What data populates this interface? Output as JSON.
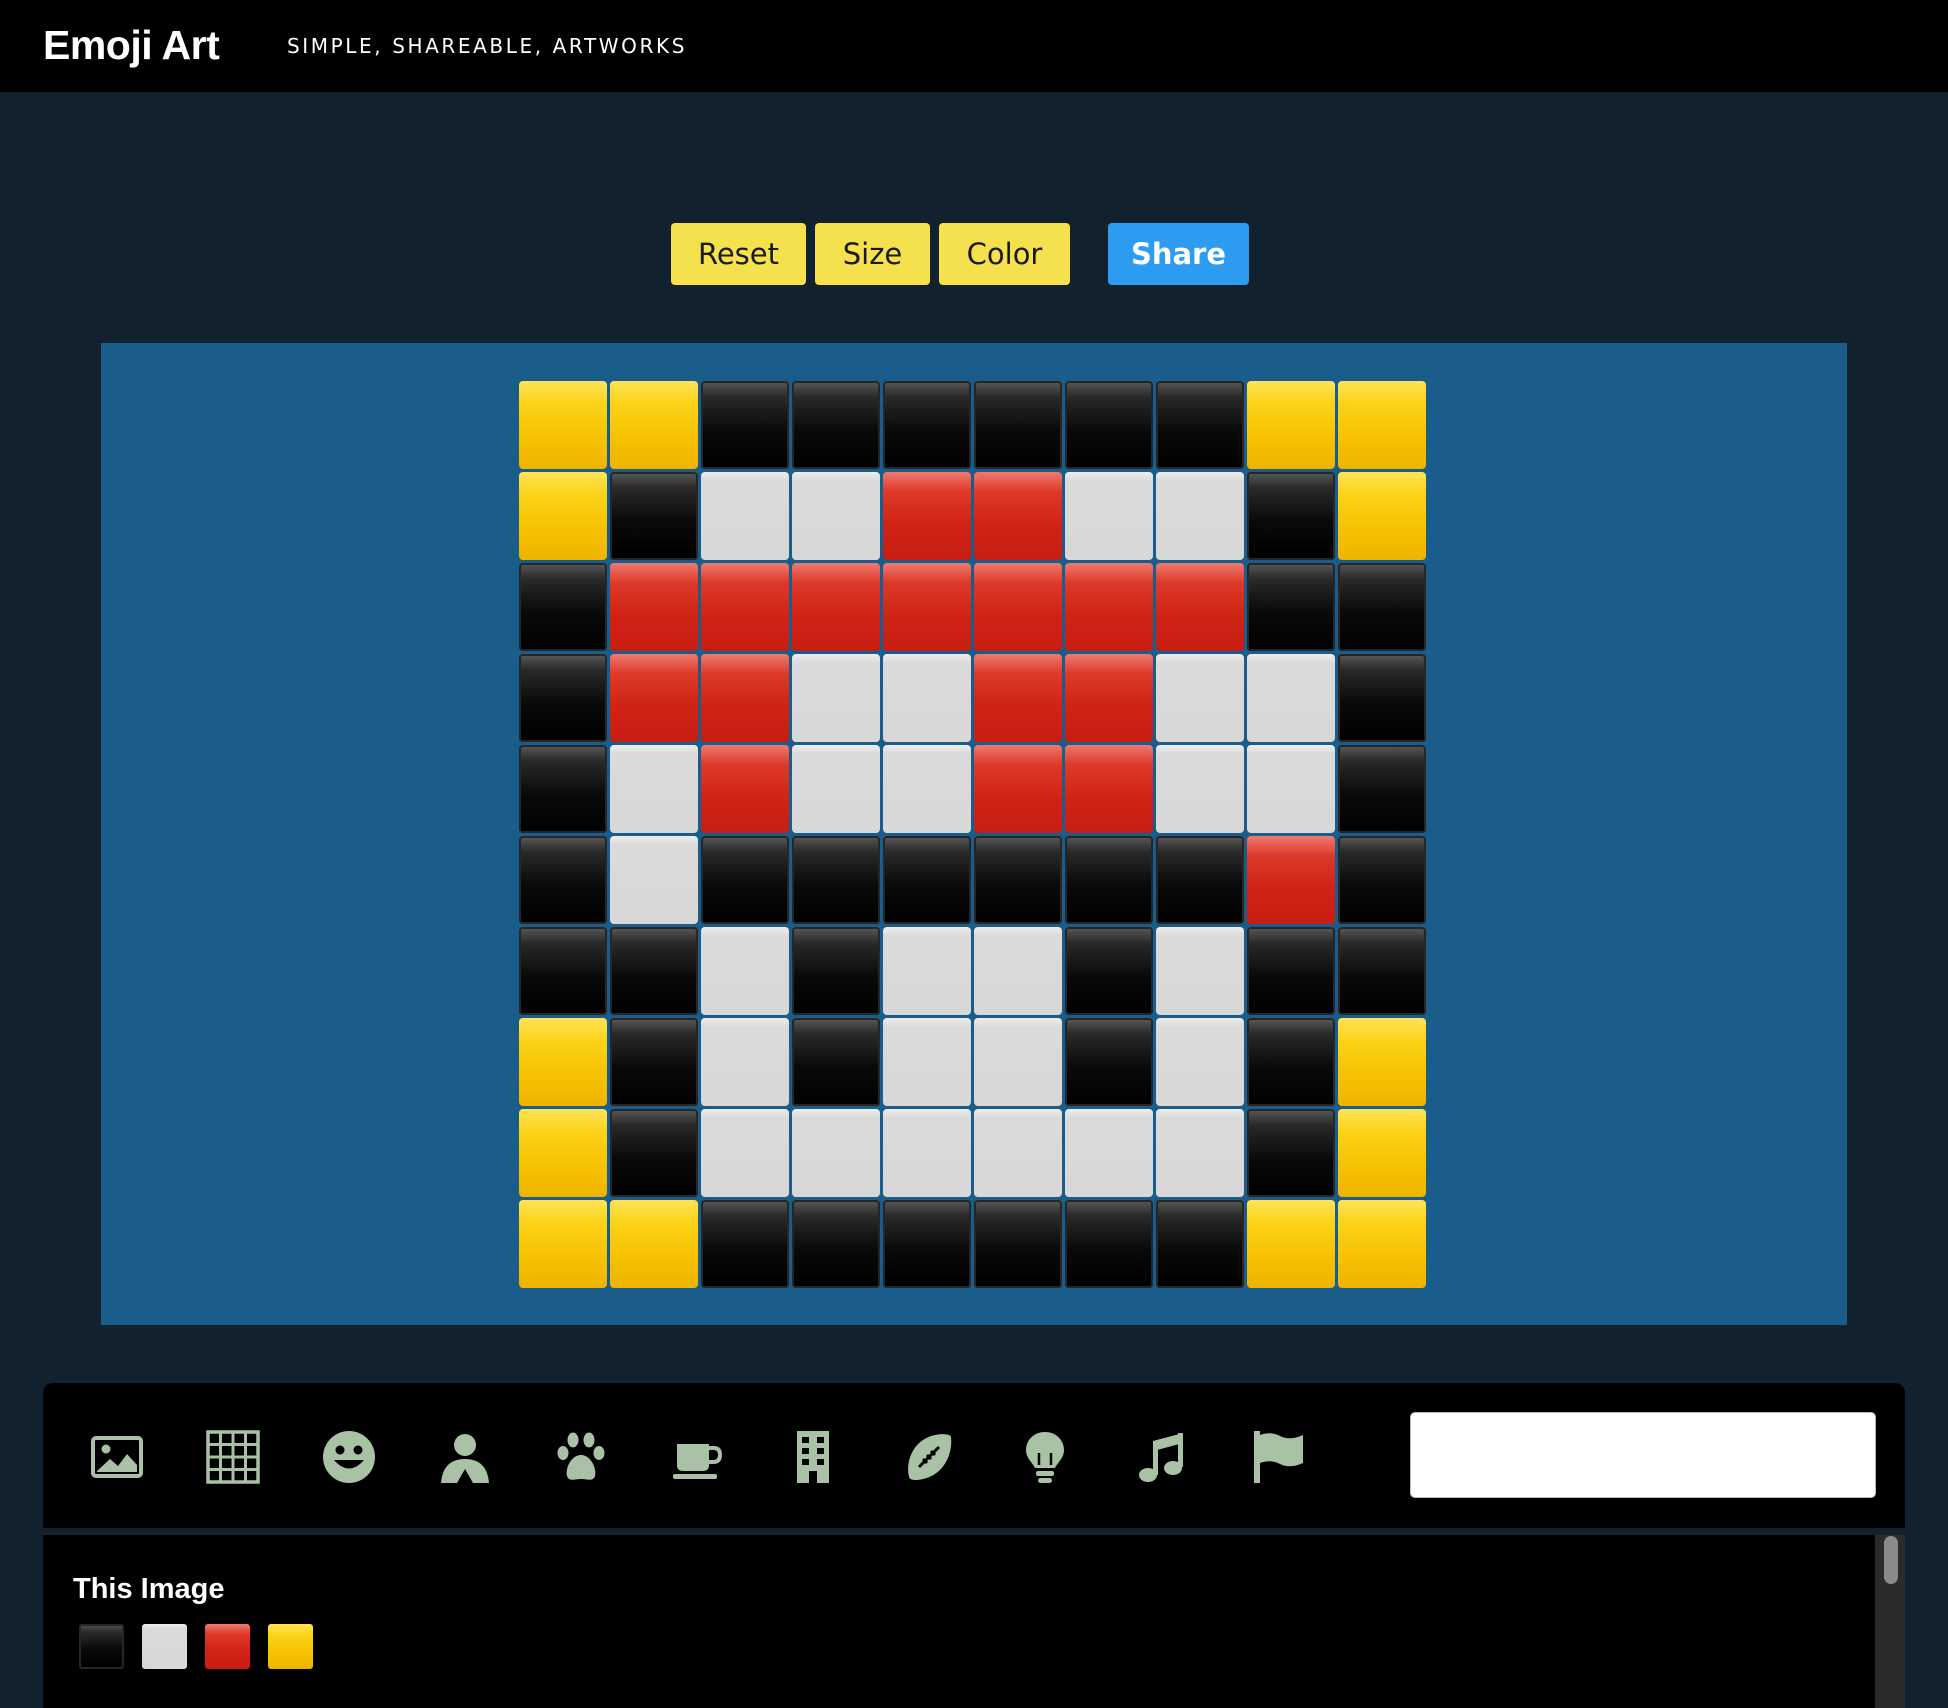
{
  "header": {
    "brand": "Emoji Art",
    "tagline": "SIMPLE, SHAREABLE, ARTWORKS"
  },
  "toolbar": {
    "reset_label": "Reset",
    "size_label": "Size",
    "color_label": "Color",
    "share_label": "Share"
  },
  "colors": {
    "B": "black-large-square",
    "W": "white-large-square",
    "R": "red-square",
    "Y": "yellow-square",
    "accent_yellow": "#f5e04e",
    "accent_blue": "#2d9cf0",
    "canvas_bg": "#1a5c8a",
    "page_bg": "#11212d"
  },
  "artwork": {
    "rows": [
      "YYBBBBBBYY",
      "YBWWRRWWBY",
      "BRRRRRRRBB",
      "BRRWWRRWWB",
      "BWRWWRRWWB",
      "BWBBBBBBRB",
      "BBWBWWBWBB",
      "YBWBWWBWBY",
      "YBWWWWWWBY",
      "YYBBBBBBYY"
    ]
  },
  "picker": {
    "categories": [
      {
        "name": "image-icon"
      },
      {
        "name": "grid-icon"
      },
      {
        "name": "smiley-icon"
      },
      {
        "name": "person-icon"
      },
      {
        "name": "paw-icon"
      },
      {
        "name": "coffee-icon"
      },
      {
        "name": "building-icon"
      },
      {
        "name": "football-icon"
      },
      {
        "name": "lightbulb-icon"
      },
      {
        "name": "music-icon"
      },
      {
        "name": "flag-icon"
      }
    ],
    "search_placeholder": "",
    "search_value": ""
  },
  "panel": {
    "title": "This Image",
    "swatches": [
      "B",
      "W",
      "R",
      "Y"
    ]
  }
}
